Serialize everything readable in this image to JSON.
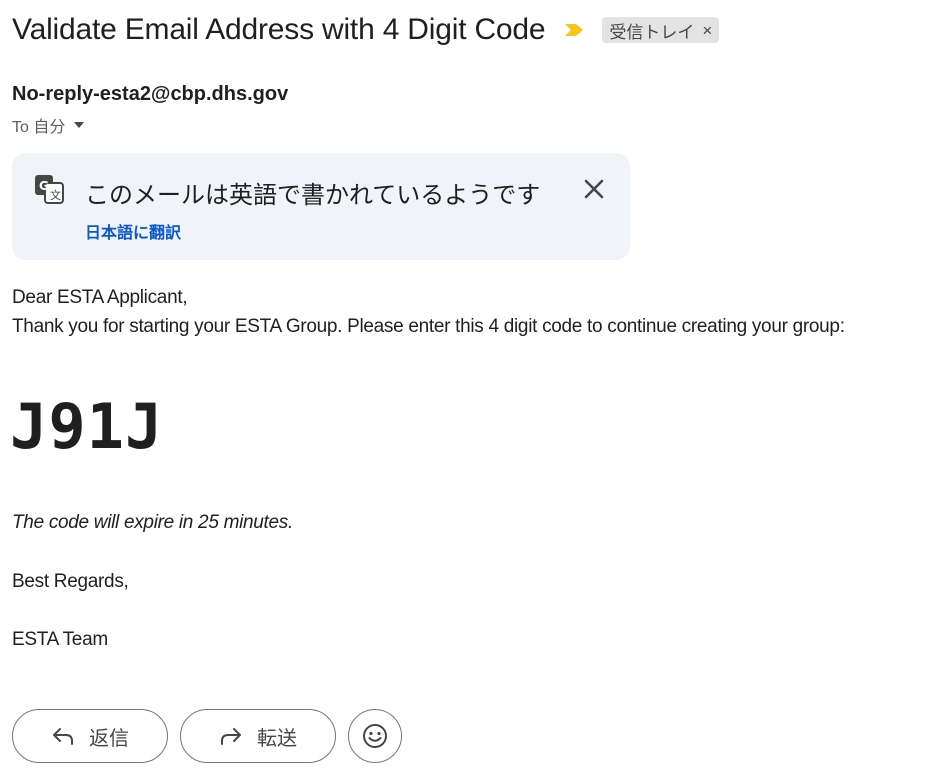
{
  "email": {
    "subject": "Validate Email Address with 4 Digit Code",
    "label": "受信トレイ",
    "label_remove": "×",
    "sender": "No-reply-esta2@cbp.dhs.gov",
    "recipient": "To 自分",
    "importance_color": "#f5c518"
  },
  "translation": {
    "message": "このメールは英語で書かれているようです",
    "action": "日本語に翻訳",
    "icon": "translate-icon",
    "close_icon": "close-icon"
  },
  "body": {
    "greeting": "Dear ESTA Applicant,",
    "intro": "Thank you for starting your ESTA Group. Please enter this 4 digit code to continue creating your group:",
    "code": "J91J",
    "expiry": "The code will expire in 25 minutes.",
    "regards": "Best Regards,",
    "team": "ESTA Team"
  },
  "actions": {
    "reply": "返信",
    "forward": "転送",
    "reply_icon": "reply-icon",
    "forward_icon": "forward-icon",
    "emoji_icon": "emoji-icon"
  }
}
